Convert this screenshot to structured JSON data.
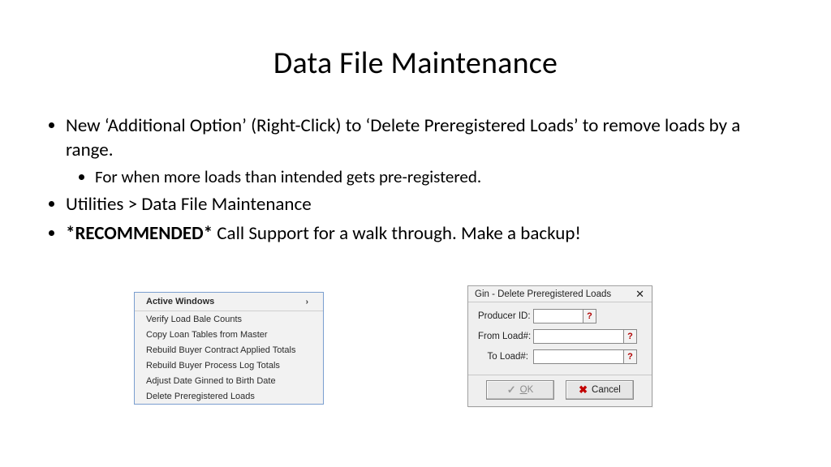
{
  "title": "Data File Maintenance",
  "bullets": {
    "b1": "New ‘Additional Option’ (Right-Click) to ‘Delete Preregistered Loads’ to remove loads by a range.",
    "b1a": "For when more loads than intended gets pre-registered.",
    "b2": "Utilities > Data File Maintenance",
    "b3_bold": "*RECOMMENDED*",
    "b3_rest": " Call Support for a walk through. Make a backup!"
  },
  "contextMenu": {
    "header": "Active Windows",
    "items": [
      "Verify Load Bale Counts",
      "Copy Loan Tables from Master",
      "Rebuild Buyer Contract Applied Totals",
      "Rebuild Buyer Process Log Totals",
      "Adjust Date Ginned to Birth Date",
      "Delete Preregistered Loads"
    ],
    "arrow": "›"
  },
  "dialog": {
    "title": "Gin - Delete Preregistered Loads",
    "closeGlyph": "✕",
    "fields": {
      "producer": {
        "label": "Producer ID:",
        "value": ""
      },
      "from": {
        "label": "From Load#:",
        "value": ""
      },
      "to": {
        "label": "To Load#:",
        "value": ""
      }
    },
    "helpGlyph": "?",
    "buttons": {
      "ok_check": "✓",
      "ok_u": "O",
      "ok_rest": "K",
      "cancel_x": "✖",
      "cancel": "Cancel"
    }
  }
}
